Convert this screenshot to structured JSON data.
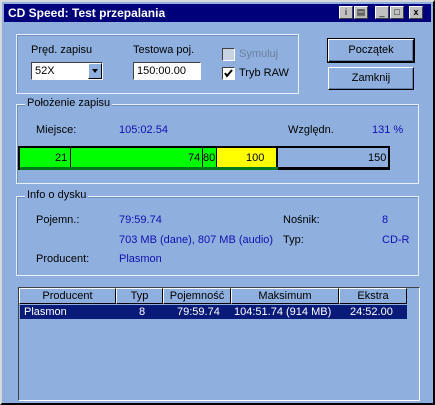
{
  "window": {
    "title": "CD Speed: Test przepalania"
  },
  "titlebar_buttons": {
    "help": "i",
    "settings": "▤",
    "minimize": "_",
    "maximize": "□",
    "close": "x"
  },
  "write": {
    "speed_label": "Pręd. zapisu",
    "speed_value": "52X",
    "test_pos_label": "Testowa poj.",
    "test_pos_value": "150:00.00",
    "simulate_label": "Symuluj",
    "simulate_checked": false,
    "raw_label": "Tryb RAW",
    "raw_checked": true
  },
  "buttons": {
    "start": "Początek",
    "close": "Zamknij"
  },
  "position": {
    "group_label": "Położenie zapisu",
    "place_label": "Miejsce:",
    "place_value": "105:02.54",
    "relative_label": "Względn.",
    "relative_value": "131 %",
    "bar_markers": [
      "21",
      "74",
      "80",
      "100",
      "150"
    ],
    "bar_max": 150,
    "bar_progress": 0.7
  },
  "disc": {
    "group_label": "Info o dysku",
    "capacity_label": "Pojemn.:",
    "capacity_value": "79:59.74",
    "capacity_detail": "703 MB (dane), 807 MB (audio)",
    "manufacturer_label": "Producent:",
    "manufacturer_value": "Plasmon",
    "media_label": "Nośnik:",
    "media_value": "8",
    "type_label": "Typ:",
    "type_value": "CD-R"
  },
  "table": {
    "columns": [
      "Producent",
      "Typ",
      "Pojemność",
      "Maksimum",
      "Ekstra"
    ],
    "rows": [
      {
        "producent": "Plasmon",
        "typ": "8",
        "pojemnosc": "79:59.74",
        "maksimum": "104:51.74 (914 MB)",
        "ekstra": "24:52.00"
      }
    ]
  },
  "colors": {
    "green": "#00ff00",
    "yellow": "#ffff00",
    "blue_zone": "#8fb0de",
    "selection": "#0a1a78"
  }
}
